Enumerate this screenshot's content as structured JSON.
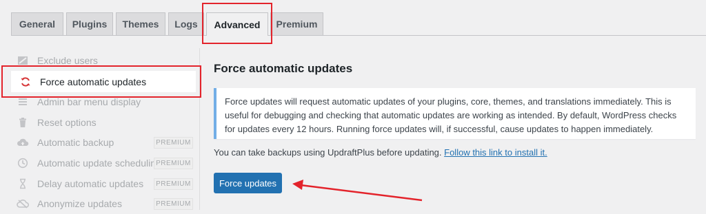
{
  "tabs": [
    {
      "label": "General"
    },
    {
      "label": "Plugins"
    },
    {
      "label": "Themes"
    },
    {
      "label": "Logs"
    },
    {
      "label": "Advanced",
      "active": true
    },
    {
      "label": "Premium"
    }
  ],
  "sidebar": {
    "items": [
      {
        "label": "Exclude users",
        "icon": "users-icon"
      },
      {
        "label": "Force automatic updates",
        "icon": "update-icon",
        "active": true
      },
      {
        "label": "Admin bar menu display",
        "icon": "menu-icon"
      },
      {
        "label": "Reset options",
        "icon": "trash-icon"
      },
      {
        "label": "Automatic backup",
        "icon": "cloud-upload-icon",
        "badge": "PREMIUM"
      },
      {
        "label": "Automatic update scheduling",
        "icon": "clock-icon",
        "badge": "PREMIUM"
      },
      {
        "label": "Delay automatic updates",
        "icon": "hourglass-icon",
        "badge": "PREMIUM"
      },
      {
        "label": "Anonymize updates",
        "icon": "cloud-icon",
        "badge": "PREMIUM"
      }
    ]
  },
  "main": {
    "title": "Force automatic updates",
    "notice_text": "Force updates will request automatic updates of your plugins, core, themes, and translations immediately. This is useful for debugging and checking that automatic updates are working as intended. By default, WordPress checks for updates every 12 hours. Running force updates will, if successful, cause updates to happen immediately.",
    "backup_text": "You can take backups using UpdraftPlus before updating. ",
    "backup_link": "Follow this link to install it.",
    "button_label": "Force updates"
  },
  "colors": {
    "accent": "#2271b1",
    "notice_border": "#72aee6",
    "highlight": "#e3232b",
    "active_icon": "#d63638"
  }
}
